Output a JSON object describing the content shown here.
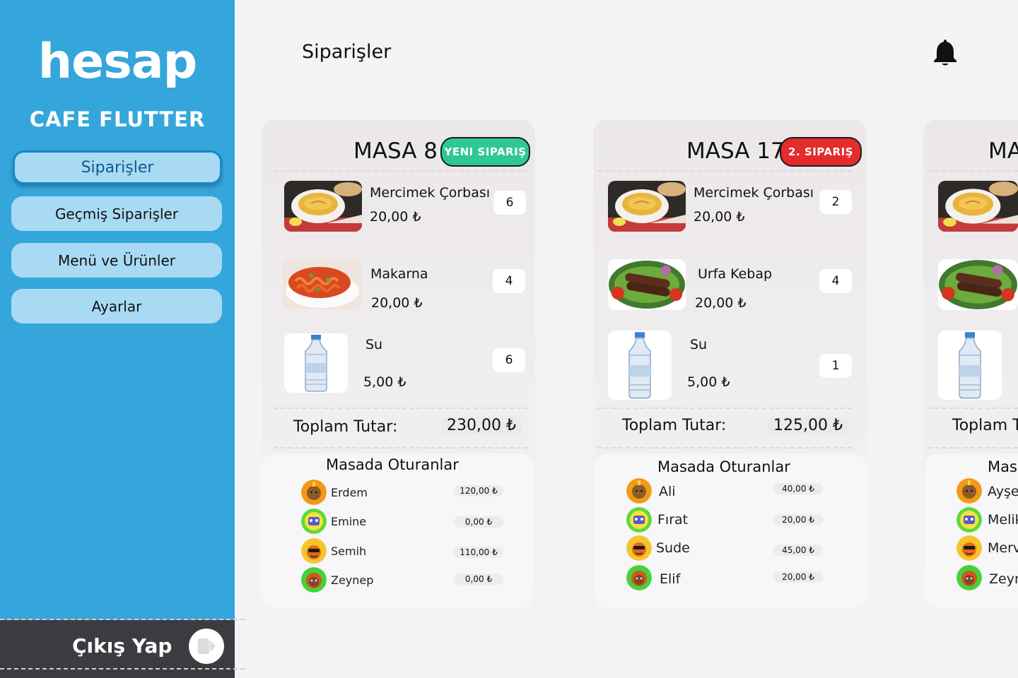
{
  "sidebar": {
    "logo": "hesap",
    "cafe": "CAFE FLUTTER",
    "nav": [
      "Siparişler",
      "Geçmiş Siparişler",
      "Menü ve Ürünler",
      "Ayarlar"
    ],
    "logout": "Çıkış Yap"
  },
  "header": {
    "title": "Siparişler"
  },
  "cards": [
    {
      "title": "MASA 8",
      "badge": "YENI SIPARIŞ",
      "items": [
        {
          "name": "Mercimek Çorbası",
          "price": "20,00 ₺",
          "qty": "6"
        },
        {
          "name": "Makarna",
          "price": "20,00 ₺",
          "qty": "4"
        },
        {
          "name": "Su",
          "price": "5,00 ₺",
          "qty": "6"
        }
      ],
      "total_label": "Toplam Tutar:",
      "total": "230,00 ₺",
      "guests_title": "Masada Oturanlar",
      "guests": [
        {
          "name": "Erdem",
          "amount": "120,00 ₺"
        },
        {
          "name": "Emine",
          "amount": "0,00 ₺"
        },
        {
          "name": "Semih",
          "amount": "110,00 ₺"
        },
        {
          "name": "Zeynep",
          "amount": "0,00 ₺"
        }
      ]
    },
    {
      "title": "MASA 17",
      "badge": "2. SIPARIŞ",
      "items": [
        {
          "name": "Mercimek Çorbası",
          "price": "20,00 ₺",
          "qty": "2"
        },
        {
          "name": "Urfa Kebap",
          "price": "20,00 ₺",
          "qty": "4"
        },
        {
          "name": "Su",
          "price": "5,00 ₺",
          "qty": "1"
        }
      ],
      "total_label": "Toplam Tutar:",
      "total": "125,00 ₺",
      "guests_title": "Masada Oturanlar",
      "guests": [
        {
          "name": "Ali",
          "amount": "40,00 ₺"
        },
        {
          "name": "Fırat",
          "amount": "20,00 ₺"
        },
        {
          "name": "Sude",
          "amount": "45,00 ₺"
        },
        {
          "name": "Elif",
          "amount": "20,00 ₺"
        }
      ]
    },
    {
      "title": "MA",
      "total_label": "Toplam T",
      "guests_title": "Mas",
      "guests": [
        {
          "name": "Ayşe"
        },
        {
          "name": "Melik"
        },
        {
          "name": "Merv"
        },
        {
          "name": "Zeyn"
        }
      ]
    }
  ],
  "colors": {
    "sidebar": "#35a6dc",
    "nav_button": "#a9daf3",
    "new_badge": "#2ec796",
    "red_badge": "#e32c2c",
    "logout_bar": "#3b3b40"
  },
  "icons": {
    "bell": "bell-icon",
    "logout": "logout-icon",
    "soup": "soup-image",
    "pasta": "pasta-image",
    "kebab": "kebab-image",
    "water": "water-bottle-image"
  }
}
